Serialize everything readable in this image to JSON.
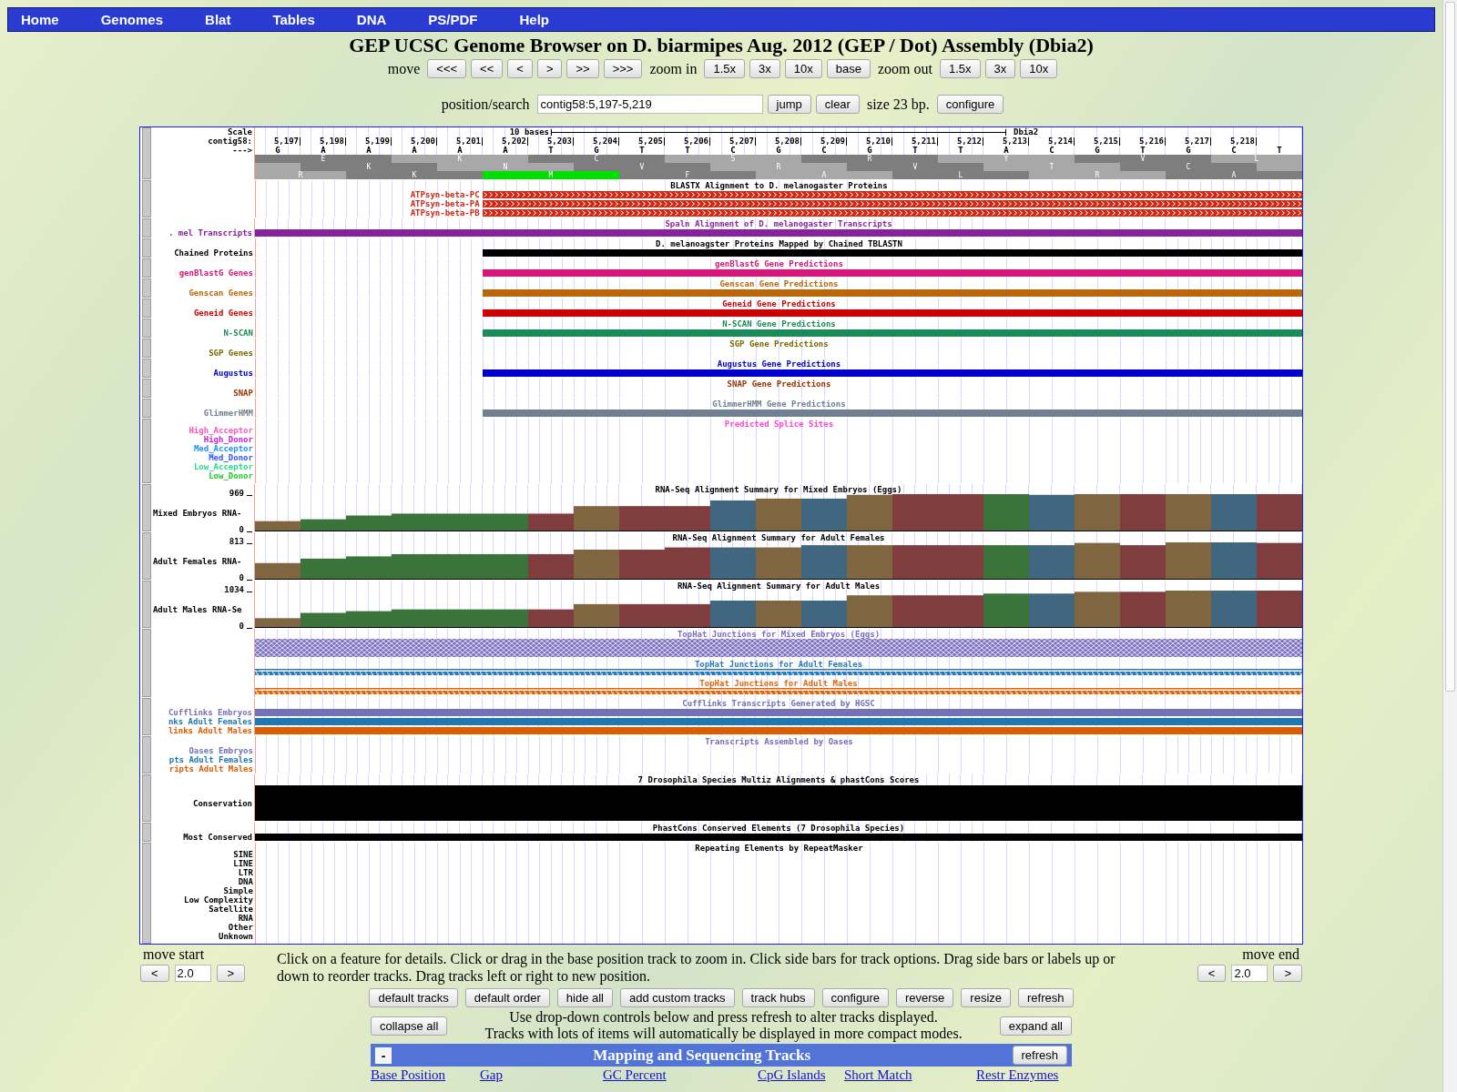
{
  "nav": [
    "Home",
    "Genomes",
    "Blat",
    "Tables",
    "DNA",
    "PS/PDF",
    "Help"
  ],
  "title": "GEP UCSC Genome Browser on D. biarmipes Aug. 2012 (GEP / Dot) Assembly (Dbia2)",
  "move": {
    "label": "move",
    "buttons": [
      "<<<",
      "<<",
      "<",
      ">",
      ">>",
      ">>>"
    ]
  },
  "zoom_in": {
    "label": "zoom in",
    "buttons": [
      "1.5x",
      "3x",
      "10x",
      "base"
    ]
  },
  "zoom_out": {
    "label": "zoom out",
    "buttons": [
      "1.5x",
      "3x",
      "10x"
    ]
  },
  "position": {
    "label": "position/search",
    "value": "contig58:5,197-5,219",
    "buttons": [
      "jump",
      "clear"
    ],
    "size": "size 23 bp.",
    "configure": "configure"
  },
  "ruler": {
    "scale_label": "Scale",
    "chrom_label": "contig58:",
    "strand_label": "--->",
    "span_label": "10 bases",
    "assembly": "Dbia2",
    "positions": [
      "5,197",
      "5,198",
      "5,199",
      "5,200",
      "5,201",
      "5,202",
      "5,203",
      "5,204",
      "5,205",
      "5,206",
      "5,207",
      "5,208",
      "5,209",
      "5,210",
      "5,211",
      "5,212",
      "5,213",
      "5,214",
      "5,215",
      "5,216",
      "5,217",
      "5,218"
    ],
    "bases": [
      "G",
      "A",
      "A",
      "A",
      "A",
      "A",
      "T",
      "G",
      "T",
      "T",
      "C",
      "G",
      "C",
      "G",
      "T",
      "T",
      "A",
      "C",
      "G",
      "T",
      "G",
      "C",
      "T"
    ],
    "frames": [
      {
        "codons": [
          {
            "aa": "E",
            "start": false
          },
          {
            "aa": "K",
            "start": false
          },
          {
            "aa": "C",
            "start": false
          },
          {
            "aa": "S",
            "start": false
          },
          {
            "aa": "R",
            "start": false
          },
          {
            "aa": "Y",
            "start": false
          },
          {
            "aa": "V",
            "start": false
          },
          {
            "aa": "L",
            "start": false
          }
        ]
      },
      {
        "codons": [
          {
            "aa": "K",
            "start": false
          },
          {
            "aa": "N",
            "start": false
          },
          {
            "aa": "V",
            "start": false
          },
          {
            "aa": "R",
            "start": false
          },
          {
            "aa": "V",
            "start": false
          },
          {
            "aa": "T",
            "start": false
          },
          {
            "aa": "C",
            "start": false
          }
        ]
      },
      {
        "codons": [
          {
            "aa": "R",
            "start": false
          },
          {
            "aa": "K",
            "start": false
          },
          {
            "aa": "M",
            "start": true
          },
          {
            "aa": "F",
            "start": false
          },
          {
            "aa": "A",
            "start": false
          },
          {
            "aa": "L",
            "start": false
          },
          {
            "aa": "R",
            "start": false
          },
          {
            "aa": "A",
            "start": false
          }
        ]
      }
    ]
  },
  "tracks": [
    {
      "kind": "blastx",
      "title": "BLASTX Alignment to D. melanogaster Proteins",
      "color": "#000000",
      "rows": [
        {
          "label": "ATPsyn-beta-PC",
          "color": "#cc2a14",
          "level": 0.783
        },
        {
          "label": "ATPsyn-beta-PA",
          "color": "#cc2a14",
          "level": 0.783
        },
        {
          "label": "ATPsyn-beta-PB",
          "color": "#cc2a14",
          "level": 0.783
        }
      ]
    },
    {
      "kind": "features",
      "title": "Spaln Alignment of D. melanogaster Transcripts",
      "color": "#8a2a9a",
      "rows": [
        {
          "label": ". mel Transcripts",
          "color": "#86229a",
          "level": 1
        }
      ]
    },
    {
      "kind": "features",
      "title": "D. melanoagster Proteins Mapped by Chained TBLASTN",
      "color": "#000000",
      "rows": [
        {
          "label": "Chained Proteins",
          "color": "#000000",
          "level": 0.783
        }
      ]
    },
    {
      "kind": "features",
      "title": "genBlastG Gene Predictions",
      "color": "#d6177a",
      "rows": [
        {
          "label": "genBlastG Genes",
          "color": "#d6177a",
          "level": 0.783
        }
      ]
    },
    {
      "kind": "features",
      "title": "Genscan Gene Predictions",
      "color": "#b8680a",
      "rows": [
        {
          "label": "Genscan Genes",
          "color": "#b8680a",
          "level": 0.783
        }
      ]
    },
    {
      "kind": "features",
      "title": "Geneid Gene Predictions",
      "color": "#cc0000",
      "rows": [
        {
          "label": "Geneid Genes",
          "color": "#cc0000",
          "level": 0.783
        }
      ]
    },
    {
      "kind": "features",
      "title": "N-SCAN Gene Predictions",
      "color": "#1d8a5a",
      "rows": [
        {
          "label": "N-SCAN",
          "color": "#1d8a5a",
          "level": 0.783
        }
      ]
    },
    {
      "kind": "features",
      "title": "SGP Gene Predictions",
      "color": "#7a6a00",
      "rows": [
        {
          "label": "SGP Genes",
          "color": "#7a6a00"
        }
      ]
    },
    {
      "kind": "features",
      "title": "Augustus Gene Predictions",
      "color": "#0000cc",
      "rows": [
        {
          "label": "Augustus",
          "color": "#0000cc",
          "level": 0.783
        }
      ]
    },
    {
      "kind": "features",
      "title": "SNAP Gene Predictions",
      "color": "#993300",
      "rows": [
        {
          "label": "SNAP",
          "color": "#993300"
        }
      ]
    },
    {
      "kind": "features",
      "title": "GlimmerHMM Gene Predictions",
      "color": "#708090",
      "rows": [
        {
          "label": "GlimmerHMM",
          "color": "#708090",
          "level": 0.783
        }
      ]
    },
    {
      "kind": "labels",
      "title": "Predicted Splice Sites",
      "color": "#ff44cc",
      "labels": [
        {
          "text": "High_Acceptor",
          "color": "#ff55bb"
        },
        {
          "text": "High_Donor",
          "color": "#cc22cc"
        },
        {
          "text": "Med_Acceptor",
          "color": "#1e90ff"
        },
        {
          "text": "Med_Donor",
          "color": "#3355ff"
        },
        {
          "text": "Low_Acceptor",
          "color": "#22dd88"
        },
        {
          "text": "Low_Donor",
          "color": "#22cc22"
        }
      ]
    },
    {
      "kind": "wiggle",
      "label": "Mixed Embryos RNA-",
      "title": "RNA-Seq Alignment Summary for Mixed Embryos (Eggs)",
      "color": "#000000",
      "chart_data": {
        "type": "bar",
        "ylim": [
          0,
          969
        ],
        "yticks": [
          {
            "value": 0,
            "label": "0"
          },
          {
            "value": 969,
            "label": "969"
          }
        ],
        "series": [
          {
            "color": "#3b743b",
            "values": [
              null,
              300,
              400,
              450,
              450,
              450,
              null,
              null,
              null,
              null,
              null,
              null,
              null,
              null,
              null,
              null,
              969,
              null,
              null,
              null,
              null,
              null,
              null
            ]
          },
          {
            "color": "#40677f",
            "values": [
              null,
              null,
              null,
              null,
              null,
              null,
              null,
              null,
              null,
              null,
              800,
              null,
              850,
              null,
              null,
              null,
              null,
              950,
              null,
              null,
              null,
              969,
              null
            ]
          },
          {
            "color": "#7f6640",
            "values": [
              250,
              null,
              null,
              null,
              null,
              null,
              null,
              650,
              null,
              null,
              null,
              850,
              null,
              950,
              null,
              null,
              null,
              null,
              969,
              null,
              969,
              null,
              null
            ]
          },
          {
            "color": "#803d3d",
            "values": [
              null,
              null,
              null,
              null,
              null,
              null,
              450,
              null,
              650,
              650,
              null,
              null,
              null,
              null,
              969,
              969,
              null,
              null,
              null,
              969,
              null,
              null,
              969
            ]
          }
        ]
      }
    },
    {
      "kind": "wiggle",
      "label": "Adult Females RNA-",
      "title": "RNA-Seq Alignment Summary for Adult Females",
      "color": "#000000",
      "chart_data": {
        "type": "bar",
        "ylim": [
          0,
          813
        ],
        "yticks": [
          {
            "value": 0,
            "label": "0"
          },
          {
            "value": 813,
            "label": "813"
          }
        ],
        "series": [
          {
            "color": "#3b743b",
            "values": [
              null,
              450,
              500,
              550,
              550,
              550,
              null,
              null,
              null,
              null,
              null,
              null,
              null,
              null,
              null,
              null,
              750,
              null,
              null,
              null,
              null,
              null,
              null
            ]
          },
          {
            "color": "#40677f",
            "values": [
              null,
              null,
              null,
              null,
              null,
              null,
              null,
              null,
              null,
              null,
              700,
              null,
              750,
              null,
              null,
              null,
              null,
              750,
              null,
              null,
              null,
              813,
              null
            ]
          },
          {
            "color": "#7f6640",
            "values": [
              350,
              null,
              null,
              null,
              null,
              null,
              null,
              650,
              null,
              null,
              null,
              700,
              null,
              750,
              null,
              null,
              null,
              null,
              800,
              null,
              813,
              null,
              null
            ]
          },
          {
            "color": "#803d3d",
            "values": [
              null,
              null,
              null,
              null,
              null,
              null,
              550,
              null,
              650,
              700,
              null,
              null,
              null,
              null,
              750,
              750,
              null,
              null,
              null,
              750,
              null,
              null,
              800
            ]
          }
        ]
      }
    },
    {
      "kind": "wiggle",
      "label": "Adult Males RNA-Se",
      "title": "RNA-Seq Alignment Summary for Adult Males",
      "color": "#000000",
      "chart_data": {
        "type": "bar",
        "ylim": [
          0,
          1034
        ],
        "yticks": [
          {
            "value": 0,
            "label": "0"
          },
          {
            "value": 1034,
            "label": "1034"
          }
        ],
        "series": [
          {
            "color": "#3b743b",
            "values": [
              null,
              400,
              450,
              500,
              500,
              500,
              null,
              null,
              null,
              null,
              null,
              null,
              null,
              null,
              null,
              null,
              950,
              null,
              null,
              null,
              null,
              null,
              null
            ]
          },
          {
            "color": "#40677f",
            "values": [
              null,
              null,
              null,
              null,
              null,
              null,
              null,
              null,
              null,
              null,
              750,
              null,
              750,
              null,
              null,
              null,
              null,
              950,
              null,
              null,
              null,
              1034,
              null
            ]
          },
          {
            "color": "#7f6640",
            "values": [
              250,
              null,
              null,
              null,
              null,
              null,
              null,
              650,
              null,
              null,
              null,
              750,
              null,
              900,
              null,
              null,
              null,
              null,
              1000,
              null,
              1034,
              null,
              null
            ]
          },
          {
            "color": "#803d3d",
            "values": [
              null,
              null,
              null,
              null,
              null,
              null,
              500,
              null,
              650,
              650,
              null,
              null,
              null,
              null,
              900,
              900,
              null,
              null,
              null,
              1000,
              null,
              null,
              1034
            ]
          }
        ]
      }
    },
    {
      "kind": "junctions",
      "rows": [
        {
          "title": "TopHat Junctions for Mixed Embryos (Eggs)",
          "color": "#7b6fc0",
          "dense": true
        },
        {
          "title": "TopHat Junctions for Adult Females",
          "color": "#2a7ab8",
          "dense": false
        },
        {
          "title": "TopHat Junctions for Adult Males",
          "color": "#e0660a",
          "dense": false
        }
      ]
    },
    {
      "kind": "features",
      "title": "Cufflinks Transcripts Generated by HGSC",
      "color": "#7670b8",
      "rows": [
        {
          "label": "Cufflinks Embryos",
          "color": "#7670b8",
          "level": 1
        },
        {
          "label": "nks Adult Females",
          "color": "#1f78b4",
          "level": 1
        },
        {
          "label": "links Adult Males",
          "color": "#dd5c00",
          "level": 1
        }
      ]
    },
    {
      "kind": "features",
      "title": "Transcripts Assembled by Oases",
      "color": "#7670b8",
      "rows": [
        {
          "label": "Oases Embryos",
          "color": "#7670b8"
        },
        {
          "label": "pts Adult Females",
          "color": "#1f78b4"
        },
        {
          "label": "ripts Adult Males",
          "color": "#dd5c00"
        }
      ]
    },
    {
      "kind": "block",
      "title": "7 Drosophila Species Multiz Alignments & phastCons Scores",
      "color": "#000000",
      "rows": [
        {
          "label": "Conservation",
          "color": "#000000",
          "level": 1
        }
      ]
    },
    {
      "kind": "features",
      "title": "PhastCons Conserved Elements (7 Drosophila Species)",
      "color": "#000000",
      "rows": [
        {
          "label": "Most Conserved",
          "color": "#000000",
          "level": 1
        }
      ]
    },
    {
      "kind": "labels",
      "title": "Repeating Elements by RepeatMasker",
      "color": "#000000",
      "labels": [
        {
          "text": "SINE",
          "color": "#000000"
        },
        {
          "text": "LINE",
          "color": "#000000"
        },
        {
          "text": "LTR",
          "color": "#000000"
        },
        {
          "text": "DNA",
          "color": "#000000"
        },
        {
          "text": "Simple",
          "color": "#000000"
        },
        {
          "text": "Low Complexity",
          "color": "#000000"
        },
        {
          "text": "Satellite",
          "color": "#000000"
        },
        {
          "text": "RNA",
          "color": "#000000"
        },
        {
          "text": "Other",
          "color": "#000000"
        },
        {
          "text": "Unknown",
          "color": "#000000"
        }
      ]
    }
  ],
  "move_start": {
    "label": "move start",
    "value": "2.0",
    "buttons": [
      "<",
      ">"
    ]
  },
  "hint": "Click on a feature for details. Click or drag in the base position track to zoom in. Click side bars for track options. Drag side bars or labels up or down to reorder tracks. Drag tracks left or right to new position.",
  "move_end": {
    "label": "move end",
    "value": "2.0",
    "buttons": [
      "<",
      ">"
    ]
  },
  "actions": [
    "default tracks",
    "default order",
    "hide all",
    "add custom tracks",
    "track hubs",
    "configure",
    "reverse",
    "resize",
    "refresh"
  ],
  "collapse_all": "collapse all",
  "expand_all": "expand all",
  "notes": [
    "Use drop-down controls below and press refresh to alter tracks displayed.",
    "Tracks with lots of items will automatically be displayed in more compact modes."
  ],
  "group": {
    "toggle": "-",
    "title": "Mapping and Sequencing Tracks",
    "refresh": "refresh",
    "links": [
      "Base Position",
      "Gap",
      "GC Percent",
      "CpG Islands",
      "Short Match",
      "Restr Enzymes"
    ]
  }
}
